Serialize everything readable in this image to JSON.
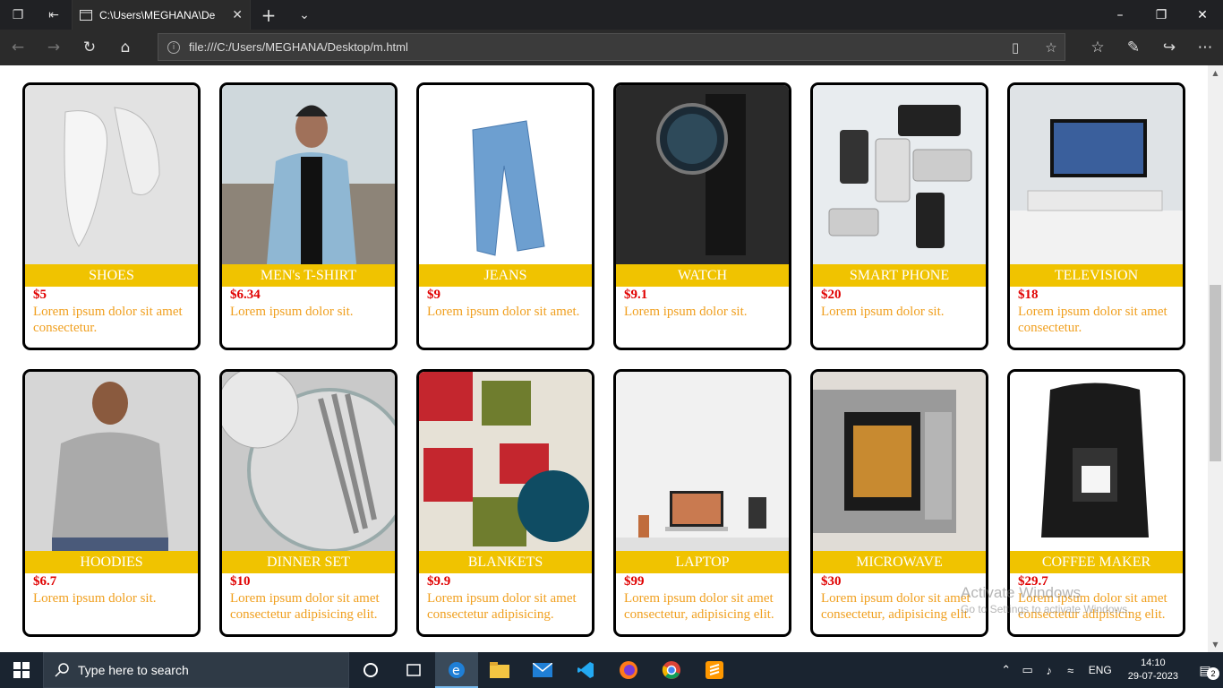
{
  "browser": {
    "tab_title": "C:\\Users\\MEGHANA\\De",
    "url": "file:///C:/Users/MEGHANA/Desktop/m.html"
  },
  "products": [
    {
      "name": "SHOES",
      "price": "$5",
      "description": "Lorem ipsum dolor sit amet consectetur."
    },
    {
      "name": "MEN's T-SHIRT",
      "price": "$6.34",
      "description": "Lorem ipsum dolor sit."
    },
    {
      "name": "JEANS",
      "price": "$9",
      "description": "Lorem ipsum dolor sit amet."
    },
    {
      "name": "WATCH",
      "price": "$9.1",
      "description": "Lorem ipsum dolor sit."
    },
    {
      "name": "SMART PHONE",
      "price": "$20",
      "description": "Lorem ipsum dolor sit."
    },
    {
      "name": "TELEVISION",
      "price": "$18",
      "description": "Lorem ipsum dolor sit amet consectetur."
    },
    {
      "name": "HOODIES",
      "price": "$6.7",
      "description": "Lorem ipsum dolor sit."
    },
    {
      "name": "DINNER SET",
      "price": "$10",
      "description": "Lorem ipsum dolor sit amet consectetur adipisicing elit."
    },
    {
      "name": "BLANKETS",
      "price": "$9.9",
      "description": "Lorem ipsum dolor sit amet consectetur adipisicing."
    },
    {
      "name": "LAPTOP",
      "price": "$99",
      "description": "Lorem ipsum dolor sit amet consectetur, adipisicing elit."
    },
    {
      "name": "MICROWAVE",
      "price": "$30",
      "description": "Lorem ipsum dolor sit amet consectetur, adipisicing elit."
    },
    {
      "name": "COFFEE MAKER",
      "price": "$29.7",
      "description": "Lorem ipsum dolor sit amet consectetur adipisicing elit."
    }
  ],
  "watermark": {
    "title": "Activate Windows",
    "subtitle": "Go to Settings to activate Windows."
  },
  "taskbar": {
    "search_placeholder": "Type here to search",
    "language": "ENG",
    "time": "14:10",
    "date": "29-07-2023",
    "notification_count": "2"
  },
  "colors": {
    "name_bar": "#f0c300",
    "price": "#e00000",
    "description": "#f0a020"
  }
}
